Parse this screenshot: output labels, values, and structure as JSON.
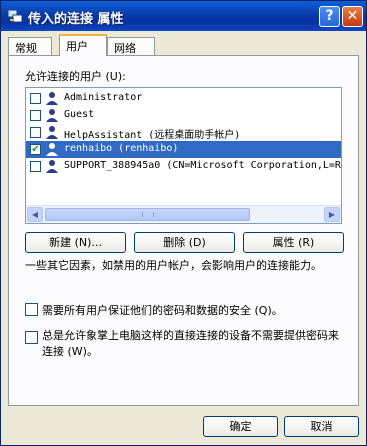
{
  "window": {
    "title": "传入的连接 属性",
    "help_label": "?",
    "close_label": "✕"
  },
  "tabs": [
    {
      "label": "常规",
      "active": false
    },
    {
      "label": "用户",
      "active": true
    },
    {
      "label": "网络",
      "active": false
    }
  ],
  "users_label": "允许连接的用户 (U):",
  "users": [
    {
      "name": "Administrator",
      "checked": false,
      "selected": false
    },
    {
      "name": "Guest",
      "checked": false,
      "selected": false
    },
    {
      "name": "HelpAssistant (远程桌面助手帐户)",
      "checked": false,
      "selected": false
    },
    {
      "name": "renhaibo (renhaibo)",
      "checked": true,
      "selected": true
    },
    {
      "name": "SUPPORT_388945a0 (CN=Microsoft Corporation,L=Re",
      "checked": false,
      "selected": false
    }
  ],
  "scroll": {
    "left": "◀",
    "right": "▶"
  },
  "buttons": {
    "new": "新建 (N)...",
    "delete": "删除 (D)",
    "properties": "属性 (R)"
  },
  "info_text": "一些其它因素，如禁用的用户帐户，会影响用户的连接能力。",
  "options": {
    "require_secure": {
      "label": "需要所有用户保证他们的密码和数据的安全 (Q)。",
      "checked": false
    },
    "allow_direct": {
      "label": "总是允许象掌上电脑这样的直接连接的设备不需要提供密码来连接 (W)。",
      "checked": false
    }
  },
  "footer": {
    "ok": "确定",
    "cancel": "取消"
  }
}
